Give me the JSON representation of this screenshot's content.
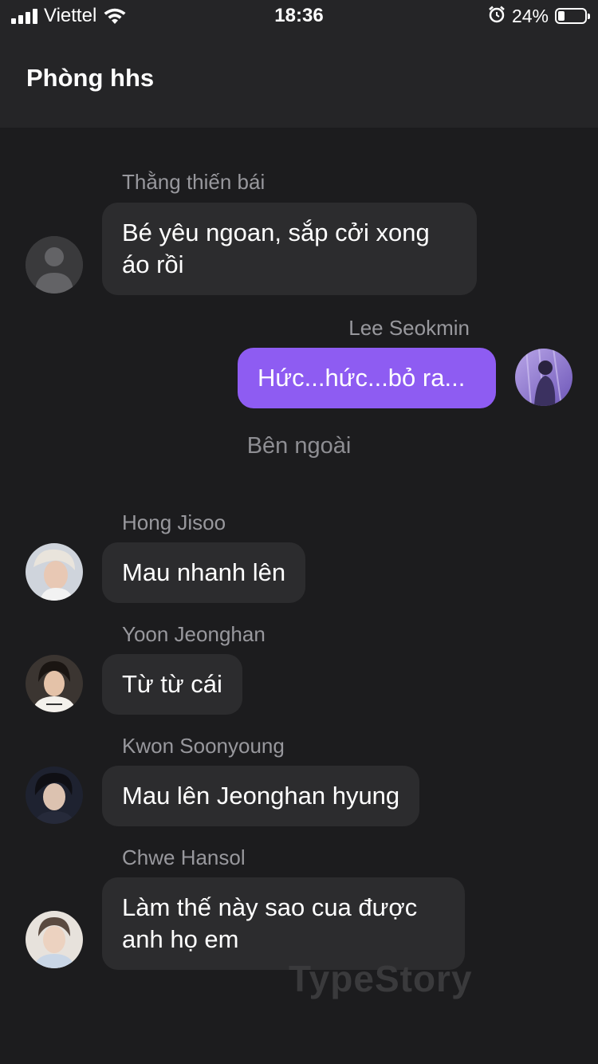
{
  "status_bar": {
    "carrier": "Viettel",
    "time": "18:36",
    "battery_percent": "24%",
    "battery_level": 0.24
  },
  "header": {
    "title": "Phòng hhs"
  },
  "messages": [
    {
      "sender": "Thằng thiến bái",
      "text": "Bé yêu ngoan, sắp cởi xong áo rồi",
      "direction": "incoming",
      "avatar": "default-person-icon"
    },
    {
      "sender": "Lee Seokmin",
      "text": "Hức...hức...bỏ ra...",
      "direction": "outgoing",
      "avatar": "user-photo"
    },
    {
      "narration": "Bên ngoài"
    },
    {
      "sender": "Hong Jisoo",
      "text": "Mau nhanh lên",
      "direction": "incoming",
      "avatar": "user-photo"
    },
    {
      "sender": "Yoon Jeonghan",
      "text": "Từ từ cái",
      "direction": "incoming",
      "avatar": "user-photo"
    },
    {
      "sender": "Kwon Soonyoung",
      "text": "Mau lên Jeonghan hyung",
      "direction": "incoming",
      "avatar": "user-photo"
    },
    {
      "sender": "Chwe Hansol",
      "text": "Làm thế này sao cua được anh họ em",
      "direction": "incoming",
      "avatar": "user-photo"
    }
  ],
  "watermark": "TypeStory",
  "colors": {
    "background": "#1c1c1e",
    "header": "#252527",
    "incoming_bubble": "#2c2c2e",
    "outgoing_bubble": "#8e5cf2",
    "sender_name": "#98989d"
  }
}
